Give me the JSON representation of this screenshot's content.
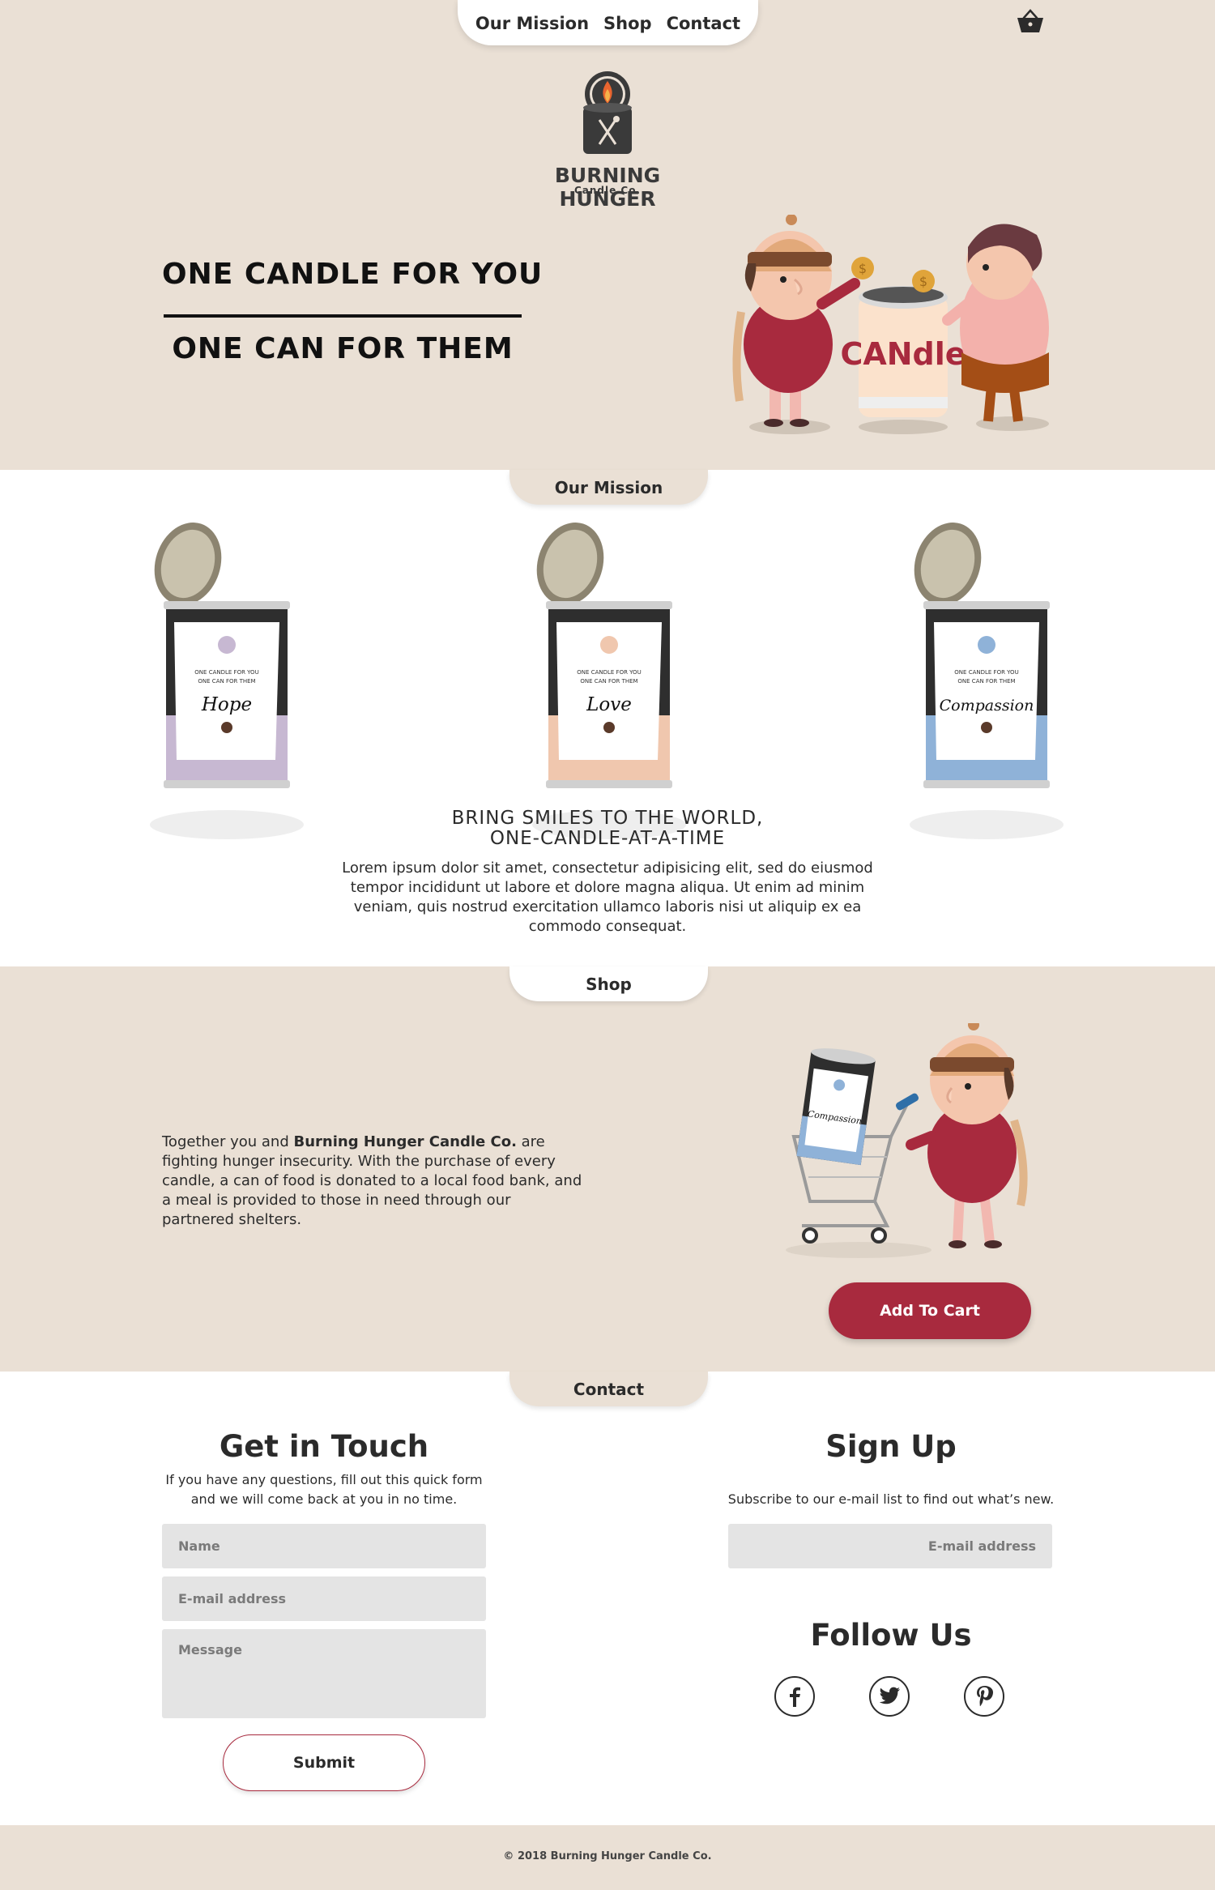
{
  "nav": {
    "links": [
      "Our Mission",
      "Shop",
      "Contact"
    ],
    "cart_icon": "basket-icon"
  },
  "logo": {
    "title": "BURNING HUNGER",
    "subtitle": "Candle Co."
  },
  "hero": {
    "tagline_1": "ONE CANDLE FOR YOU",
    "tagline_2": "ONE CAN FOR THEM",
    "illustration_text": "CANdle"
  },
  "mission": {
    "tab": "Our Mission",
    "cans": [
      {
        "label": "Hope",
        "color": "#c7b8d2"
      },
      {
        "label": "Love",
        "color": "#f0c7ae"
      },
      {
        "label": "Compassion",
        "color": "#8fb2d8"
      }
    ],
    "can_label_line1": "ONE CANDLE FOR YOU",
    "can_label_line2": "ONE CAN FOR THEM",
    "heading_line1": "BRING SMILES TO THE WORLD,",
    "heading_line2": "ONE-CANDLE-AT-A-TIME",
    "body": "Lorem ipsum dolor sit amet, consectetur adipisicing elit, sed do eiusmod tempor incididunt ut labore et dolore magna aliqua. Ut enim ad minim veniam, quis nostrud exercitation ullamco  laboris nisi ut aliquip ex ea commodo consequat."
  },
  "shop": {
    "tab": "Shop",
    "text_pre": "Together you and ",
    "text_bold": "Burning Hunger Candle Co.",
    "text_post": " are fighting hunger insecurity. With the purchase of every candle, a can of food is donated to a local food bank, and a meal is provided to those in need through our partnered shelters.",
    "cart_can_label": "Compassion",
    "add_to_cart": "Add To Cart"
  },
  "contact": {
    "tab": "Contact",
    "get_in_touch": "Get in Touch",
    "get_in_touch_desc": "If you have any questions, fill out this quick form and we will come back at you in no time.",
    "name_placeholder": "Name",
    "email_placeholder": "E-mail address",
    "message_placeholder": "Message",
    "submit": "Submit",
    "sign_up": "Sign Up",
    "sign_up_desc": "Subscribe to our e-mail list to find out what’s new.",
    "signup_email_placeholder": "E-mail address",
    "follow_us": "Follow Us",
    "social_icons": [
      "facebook-icon",
      "twitter-icon",
      "pinterest-icon"
    ]
  },
  "footer": {
    "copyright": "© 2018 Burning Hunger Candle Co."
  },
  "colors": {
    "beige": "#eae0d5",
    "accent_red": "#a82a3e",
    "field_gray": "#e4e4e4"
  }
}
